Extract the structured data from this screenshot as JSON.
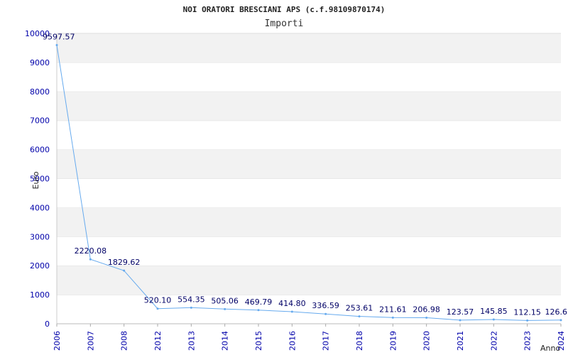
{
  "chart_data": {
    "type": "line",
    "title": "NOI ORATORI BRESCIANI APS (c.f.98109870174)",
    "subtitle": "Importi",
    "ylabel": "Euro",
    "xlabel": "Anno",
    "ylim": [
      0,
      10000
    ],
    "yticks": [
      "0",
      "1000",
      "2000",
      "3000",
      "4000",
      "5000",
      "6000",
      "7000",
      "8000",
      "9000",
      "10000"
    ],
    "grid": "horizontal-bands",
    "categories": [
      "2006",
      "2007",
      "2008",
      "2012",
      "2013",
      "2014",
      "2015",
      "2016",
      "2017",
      "2018",
      "2019",
      "2020",
      "2021",
      "2022",
      "2023",
      "2024"
    ],
    "values": [
      9597.57,
      2220.08,
      1829.62,
      520.1,
      554.35,
      505.06,
      469.79,
      414.8,
      336.59,
      253.61,
      211.61,
      206.98,
      123.57,
      145.85,
      112.15,
      126.6
    ],
    "labels": [
      "9597.57",
      "2220.08",
      "1829.62",
      "520.10",
      "554.35",
      "505.06",
      "469.79",
      "414.80",
      "336.59",
      "253.61",
      "211.61",
      "206.98",
      "123.57",
      "145.85",
      "112.15",
      "126.6"
    ],
    "colors": {
      "line": "#66aaee",
      "band": "#f2f2f2",
      "tick": "#0000aa",
      "label": "#000066"
    }
  }
}
